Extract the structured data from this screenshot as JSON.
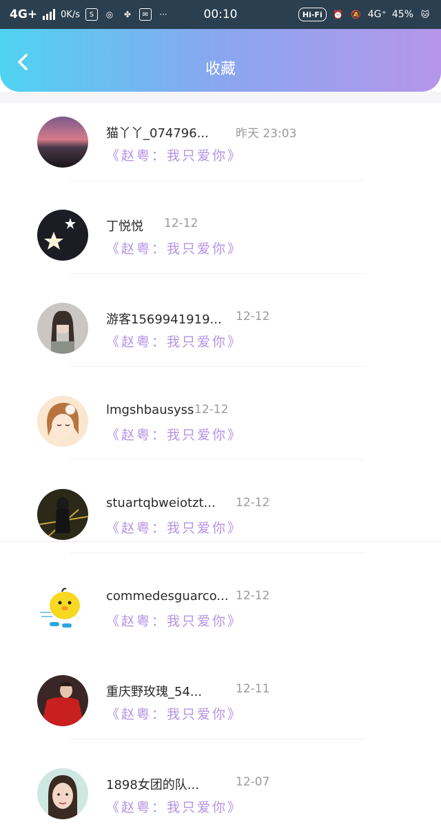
{
  "status_bar": {
    "network": "4G+",
    "speed": "0K/s",
    "time": "00:10",
    "hifi": "Hi-Fi",
    "network2": "4G⁺",
    "battery": "45%"
  },
  "header": {
    "title": "收藏",
    "accent_start": "#4fd3f2",
    "accent_end": "#b596ea"
  },
  "list": [
    {
      "name": "猫丫丫_074796...",
      "time": "昨天 23:03",
      "quote": "《赵粤：我只爱你》"
    },
    {
      "name": "丁悦悦",
      "time": "12-12",
      "quote": "《赵粤：我只爱你》"
    },
    {
      "name": "游客1569941919...",
      "time": "12-12",
      "quote": "《赵粤：我只爱你》"
    },
    {
      "name": "lmgshbausyss",
      "time": "12-12",
      "quote": "《赵粤：我只爱你》"
    },
    {
      "name": "stuartqbweiotzt...",
      "time": "12-12",
      "quote": "《赵粤：我只爱你》"
    },
    {
      "name": "commedesguarco...",
      "time": "12-12",
      "quote": "《赵粤：我只爱你》"
    },
    {
      "name": "重庆野玫瑰_54...",
      "time": "12-11",
      "quote": "《赵粤：我只爱你》"
    },
    {
      "name": "1898女团的队...",
      "time": "12-07",
      "quote": "《赵粤：我只爱你》"
    }
  ],
  "colors": {
    "quote": "#b392e6",
    "name": "#2a2a2a",
    "time": "#9a9a9a"
  }
}
